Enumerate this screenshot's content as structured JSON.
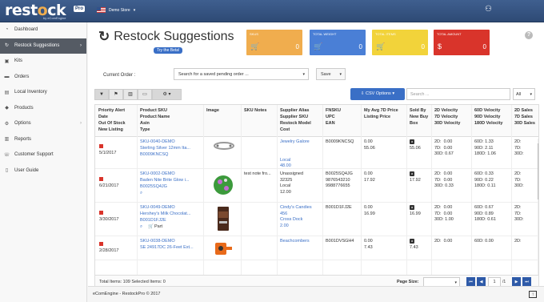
{
  "app": {
    "logo": "restock",
    "logo_tag": "Pro",
    "logo_by": "by eComEngine",
    "store": "Demo Store"
  },
  "sidebar": {
    "items": [
      {
        "label": "Dashboard",
        "icon": "dashboard-icon"
      },
      {
        "label": "Restock Suggestions",
        "icon": "refresh-icon"
      },
      {
        "label": "Kits",
        "icon": "kit-icon"
      },
      {
        "label": "Orders",
        "icon": "truck-icon"
      },
      {
        "label": "Local Inventory",
        "icon": "inventory-icon"
      },
      {
        "label": "Products",
        "icon": "tag-icon"
      },
      {
        "label": "Options",
        "icon": "gear-icon"
      },
      {
        "label": "Reports",
        "icon": "chart-icon"
      },
      {
        "label": "Customer Support",
        "icon": "support-icon"
      },
      {
        "label": "User Guide",
        "icon": "guide-icon"
      }
    ]
  },
  "page": {
    "title": "Restock Suggestions",
    "beta": "Try the Beta!"
  },
  "tiles": [
    {
      "label": "SKUS",
      "value": "0",
      "color": "#f0ad4e",
      "icon": "cart-icon"
    },
    {
      "label": "TOTAL WEIGHT",
      "value": "0",
      "color": "#4a7fd6",
      "icon": "cart-icon"
    },
    {
      "label": "TOTAL ITEMS",
      "value": "0",
      "color": "#f2d33a",
      "icon": "cart-icon"
    },
    {
      "label": "TOTAL AMOUNT",
      "value": "0",
      "color": "#d9342b",
      "icon": "dollar-icon"
    }
  ],
  "order": {
    "label": "Current Order :",
    "placeholder": "Search for a saved pending order ...",
    "save": "Save"
  },
  "toolbar": {
    "csv": "CSV Options",
    "search_placeholder": "Search ...",
    "filter": "All"
  },
  "table": {
    "headers": [
      "Priority Alert\nDate\nOut Of Stock\nNew Listing",
      "Product SKU\nProduct Name\nAsin\nType",
      "Image",
      "SKU Notes",
      "Supplier Alias\nSupplier SKU\nRestock Model\nCost",
      "FNSKU\nUPC\nEAN",
      "My Avg 7D Price\nListing Price",
      "Sold By\nNew Buy\nBox",
      "2D Velocity\n7D Velocity\n30D Velocity",
      "60D Velocity\n90D Velocity\n180D Velocity",
      "2D Sales\n7D Sales\n30D Sales"
    ],
    "rows": [
      {
        "date": "5/1/2017",
        "sku": "SKU-0040-DEMO",
        "name": "Sterling Silver 12mm Ita...",
        "asin": "B0009KNCSQ",
        "type": "",
        "notes": "",
        "supplier": "Jewelry Galore\n\n\nLocal\n48.00",
        "fnsku": "B0009KNCSQ",
        "price": "0.00\n55.06",
        "buybox": "55.06",
        "v1": "2D:  0.00\n7D:  0.00\n30D: 0.67",
        "v2": "60D: 1.33\n90D: 2.11\n180D: 1.06",
        "s": "2D:\n7D:\n30D:"
      },
      {
        "date": "6/21/2017",
        "sku": "SKU-0002-DEMO",
        "name": "Baden Nite Brite Glow i...",
        "asin": "B0025SQ4JG",
        "type": "",
        "notes": "test note fro...",
        "supplier": "Unassigned\n32325\nLocal\n12.00",
        "fnsku": "B0025SQ4JG\n9876543210\n9988776655",
        "price": "0.00\n17.92",
        "buybox": "17.92",
        "v1": "2D:  0.00\n7D:  0.00\n30D: 0.33",
        "v2": "60D: 0.33\n90D: 0.22\n180D: 0.11",
        "s": "2D:\n7D:\n30D:"
      },
      {
        "date": "3/30/2017",
        "sku": "SKU-0049-DEMO",
        "name": "Hershey's Milk Chocolat...",
        "asin": "B001D1FJ2E",
        "type": "Part",
        "notes": "",
        "supplier": "Cindy's Candies\n456\nCross Dock\n2.00",
        "fnsku": "B001D1FJ2E",
        "price": "0.00\n16.99",
        "buybox": "16.99",
        "v1": "2D:  0.00\n7D:  0.00\n30D: 1.00",
        "v2": "60D: 0.67\n90D: 0.89\n180D: 0.61",
        "s": "2D:\n7D:\n30D:"
      },
      {
        "date": "2/28/2017",
        "sku": "SKU-0038-DEMO",
        "name": "SE 24917DC 26-Feet Ext...",
        "asin": "",
        "type": "",
        "notes": "",
        "supplier": "Beachcombers",
        "fnsku": "B001DVSGH4",
        "price": "0.00\n7.43",
        "buybox": "7.43",
        "v1": "2D:  0.00",
        "v2": "60D: 0.00",
        "s": "2D:"
      }
    ]
  },
  "footer_bar": {
    "total": "Total Items: 109 Selected Items: 0",
    "page_size": "Page Size:",
    "page": "1",
    "of": "/1"
  },
  "footer": {
    "copyright": "eComEngine - RestockPro © 2017"
  }
}
